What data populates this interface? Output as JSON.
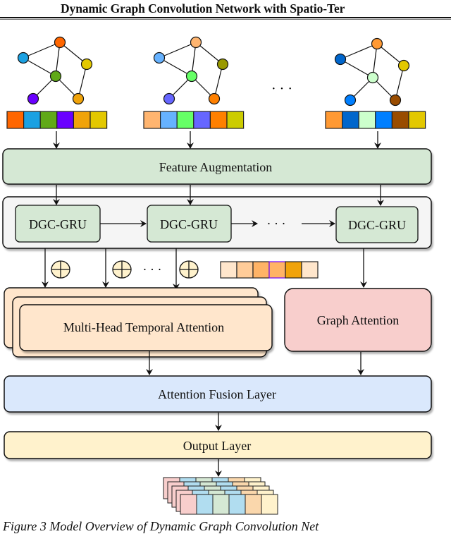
{
  "header": {
    "title": "Dynamic Graph Convolution Network with Spatio-Ter"
  },
  "graphs": [
    {
      "node_colors": [
        "#ff6600",
        "#1ba1e2",
        "#60a917",
        "#e3c800",
        "#6a00ff",
        "#f0a30a"
      ],
      "feature_colors": [
        "#ff6600",
        "#1ba1e2",
        "#60a917",
        "#6a00ff",
        "#f0a30a",
        "#e3c800"
      ]
    },
    {
      "node_colors": [
        "#ffb570",
        "#66b2ff",
        "#66ff66",
        "#999900",
        "#6666ff",
        "#ff8000"
      ],
      "feature_colors": [
        "#ffb570",
        "#66b2ff",
        "#66ff66",
        "#6666ff",
        "#ff8000",
        "#cccc00"
      ]
    },
    {
      "node_colors": [
        "#ff9933",
        "#0066cc",
        "#ccffcc",
        "#e3c800",
        "#007fff",
        "#994c00"
      ],
      "feature_colors": [
        "#ff9933",
        "#0066cc",
        "#ccffcc",
        "#007fff",
        "#994c00",
        "#e3c800"
      ]
    }
  ],
  "ellipsis": "· · ·",
  "feature_augmentation": {
    "label": "Feature Augmentation",
    "color": "#d5e8d4"
  },
  "dgc_gru": {
    "label": "DGC-GRU",
    "cells": [
      "DGC-GRU",
      "DGC-GRU",
      "DGC-GRU"
    ],
    "container_color": "#f5f5f5",
    "cell_color": "#d5e8d4"
  },
  "plus_symbol_color": "#fff2cc",
  "embedding_colors": [
    "#ffe6cc",
    "#ffcc99",
    "#ffb366",
    "#ffb366",
    "#f0a30a",
    "#ffe6cc"
  ],
  "temporal_attention": {
    "label": "Multi-Head Temporal Attention",
    "color": "#ffe6cc"
  },
  "graph_attention": {
    "label": "Graph Attention",
    "color": "#f8cecc"
  },
  "attention_fusion": {
    "label": "Attention Fusion Layer",
    "color": "#dae8fc"
  },
  "output_layer": {
    "label": "Output Layer",
    "color": "#fff2cc"
  },
  "output_tensor_colors": [
    "#f8cecc",
    "#b1ddf0",
    "#d5e8d4",
    "#b1ddf0",
    "#fad7ac",
    "#fff2cc"
  ],
  "caption": "Figure 3 Model Overview of Dynamic Graph Convolution Net"
}
